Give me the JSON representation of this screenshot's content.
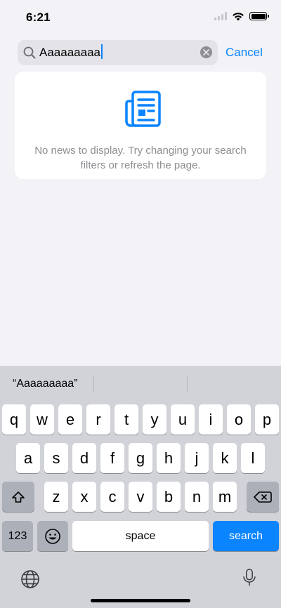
{
  "status_bar": {
    "time": "6:21"
  },
  "search": {
    "value": "Aaaaaaaaa",
    "cancel_label": "Cancel"
  },
  "empty_state": {
    "icon": "news-icon",
    "message": "No news to display. Try changing your search filters or refresh the page."
  },
  "keyboard": {
    "suggestion": "“Aaaaaaaaa”",
    "row1": [
      "q",
      "w",
      "e",
      "r",
      "t",
      "y",
      "u",
      "i",
      "o",
      "p"
    ],
    "row2": [
      "a",
      "s",
      "d",
      "f",
      "g",
      "h",
      "j",
      "k",
      "l"
    ],
    "row3": [
      "z",
      "x",
      "c",
      "v",
      "b",
      "n",
      "m"
    ],
    "numbers_label": "123",
    "space_label": "space",
    "search_label": "search"
  },
  "colors": {
    "accent": "#0a84ff",
    "background": "#f2f2f7",
    "keyboard": "#d1d3d9"
  }
}
